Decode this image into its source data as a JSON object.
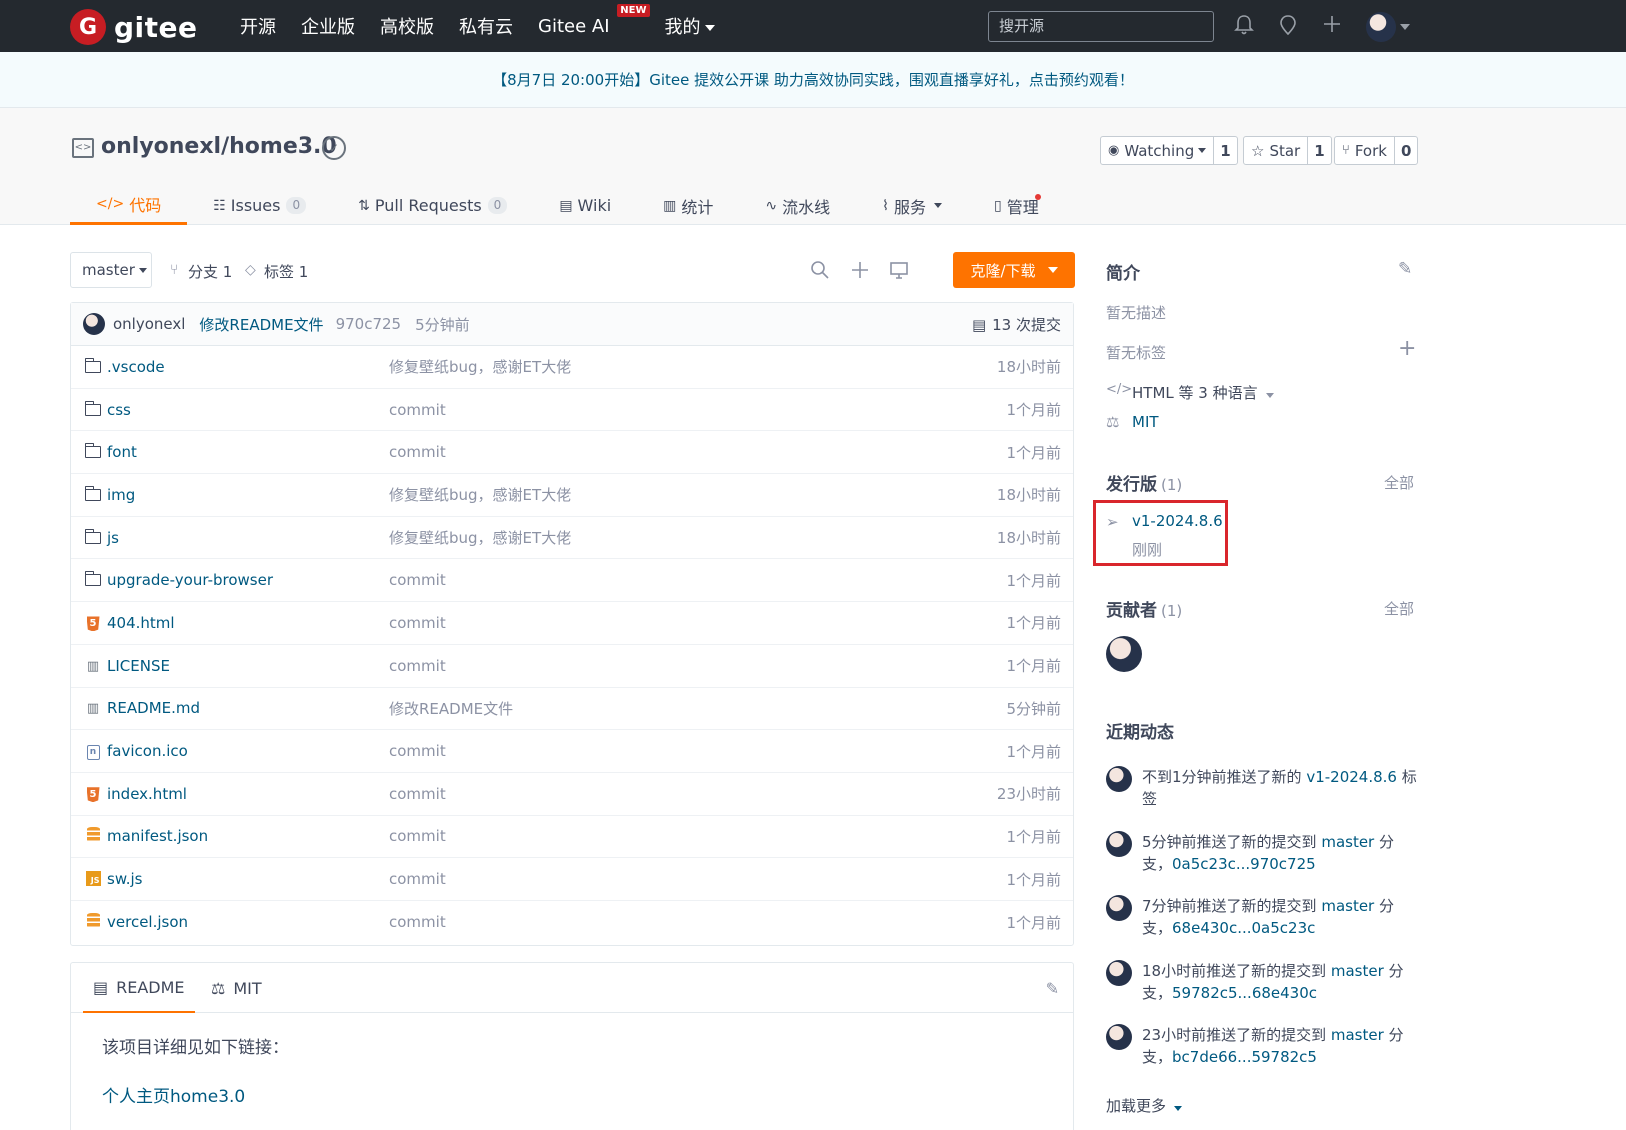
{
  "nav": {
    "logo_text": "gitee",
    "logo_letter": "G",
    "links": [
      "开源",
      "企业版",
      "高校版",
      "私有云",
      "Gitee AI",
      "我的"
    ],
    "new_badge": "NEW",
    "search_placeholder": "搜开源"
  },
  "banner": "【8月7日 20:00开始】Gitee 提效公开课 助力高效协同实践，围观直播享好礼，点击预约观看！",
  "repo": {
    "title": "onlyonexl/home3.0",
    "watching_label": "Watching",
    "watching_count": "1",
    "star_label": "Star",
    "star_count": "1",
    "fork_label": "Fork",
    "fork_count": "0"
  },
  "tabs": [
    {
      "label": "代码",
      "num": ""
    },
    {
      "label": "Issues",
      "num": "0"
    },
    {
      "label": "Pull Requests",
      "num": "0"
    },
    {
      "label": "Wiki",
      "num": ""
    },
    {
      "label": "统计",
      "num": ""
    },
    {
      "label": "流水线",
      "num": ""
    },
    {
      "label": "服务",
      "num": ""
    },
    {
      "label": "管理",
      "num": ""
    }
  ],
  "toolbar": {
    "branch": "master",
    "branches": "分支 1",
    "tags": "标签 1",
    "clone_label": "克隆/下载"
  },
  "commit": {
    "author": "onlyonexl",
    "message": "修改README文件",
    "sha": "970c725",
    "time": "5分钟前",
    "count": "13 次提交"
  },
  "files": [
    {
      "name": ".vscode",
      "msg": "修复壁纸bug，感谢ET大佬",
      "time": "18小时前",
      "icon": "folder-icon"
    },
    {
      "name": "css",
      "msg": "commit",
      "time": "1个月前",
      "icon": "folder-icon"
    },
    {
      "name": "font",
      "msg": "commit",
      "time": "1个月前",
      "icon": "folder-icon"
    },
    {
      "name": "img",
      "msg": "修复壁纸bug，感谢ET大佬",
      "time": "18小时前",
      "icon": "folder-icon"
    },
    {
      "name": "js",
      "msg": "修复壁纸bug，感谢ET大佬",
      "time": "18小时前",
      "icon": "folder-icon"
    },
    {
      "name": "upgrade-your-browser",
      "msg": "commit",
      "time": "1个月前",
      "icon": "folder-icon"
    },
    {
      "name": "404.html",
      "msg": "commit",
      "time": "1个月前",
      "icon": "html-file-icon"
    },
    {
      "name": "LICENSE",
      "msg": "commit",
      "time": "1个月前",
      "icon": "book-file-icon"
    },
    {
      "name": "README.md",
      "msg": "修改README文件",
      "time": "5分钟前",
      "icon": "book-file-icon"
    },
    {
      "name": "favicon.ico",
      "msg": "commit",
      "time": "1个月前",
      "icon": "image-file-icon"
    },
    {
      "name": "index.html",
      "msg": "commit",
      "time": "23小时前",
      "icon": "html-file-icon"
    },
    {
      "name": "manifest.json",
      "msg": "commit",
      "time": "1个月前",
      "icon": "database-file-icon"
    },
    {
      "name": "sw.js",
      "msg": "commit",
      "time": "1个月前",
      "icon": "js-file-icon"
    },
    {
      "name": "vercel.json",
      "msg": "commit",
      "time": "1个月前",
      "icon": "database-file-icon"
    }
  ],
  "readme": {
    "tab_readme": "README",
    "tab_license": "MIT",
    "line1": "该项目详细见如下链接：",
    "link": "个人主页home3.0"
  },
  "sidebar": {
    "intro_title": "简介",
    "no_desc": "暂无描述",
    "no_tags": "暂无标签",
    "language": "HTML 等 3 种语言",
    "license": "MIT",
    "releases_title": "发行版",
    "releases_count": "(1)",
    "all": "全部",
    "release_name": "v1-2024.8.6",
    "release_time": "刚刚",
    "contributors_title": "贡献者",
    "contributors_count": "(1)",
    "activity_title": "近期动态",
    "load_more": "加载更多"
  },
  "activity": [
    {
      "pre": "不到1分钟前推送了新的 ",
      "hl": "v1-2024.8.6",
      "mid": " 标签",
      "hl2": ""
    },
    {
      "pre": "5分钟前推送了新的提交到 ",
      "hl": "master",
      "mid": " 分支，",
      "hl2": "0a5c23c...970c725"
    },
    {
      "pre": "7分钟前推送了新的提交到 ",
      "hl": "master",
      "mid": " 分支，",
      "hl2": "68e430c...0a5c23c"
    },
    {
      "pre": "18小时前推送了新的提交到 ",
      "hl": "master",
      "mid": " 分支，",
      "hl2": "59782c5...68e430c"
    },
    {
      "pre": "23小时前推送了新的提交到 ",
      "hl": "master",
      "mid": " 分支，",
      "hl2": "bc7de66...59782c5"
    }
  ],
  "colors": {
    "accent": "#fe7300",
    "nav_bg": "#24292f",
    "link": "#005980",
    "highlight_box": "#d9262c"
  }
}
